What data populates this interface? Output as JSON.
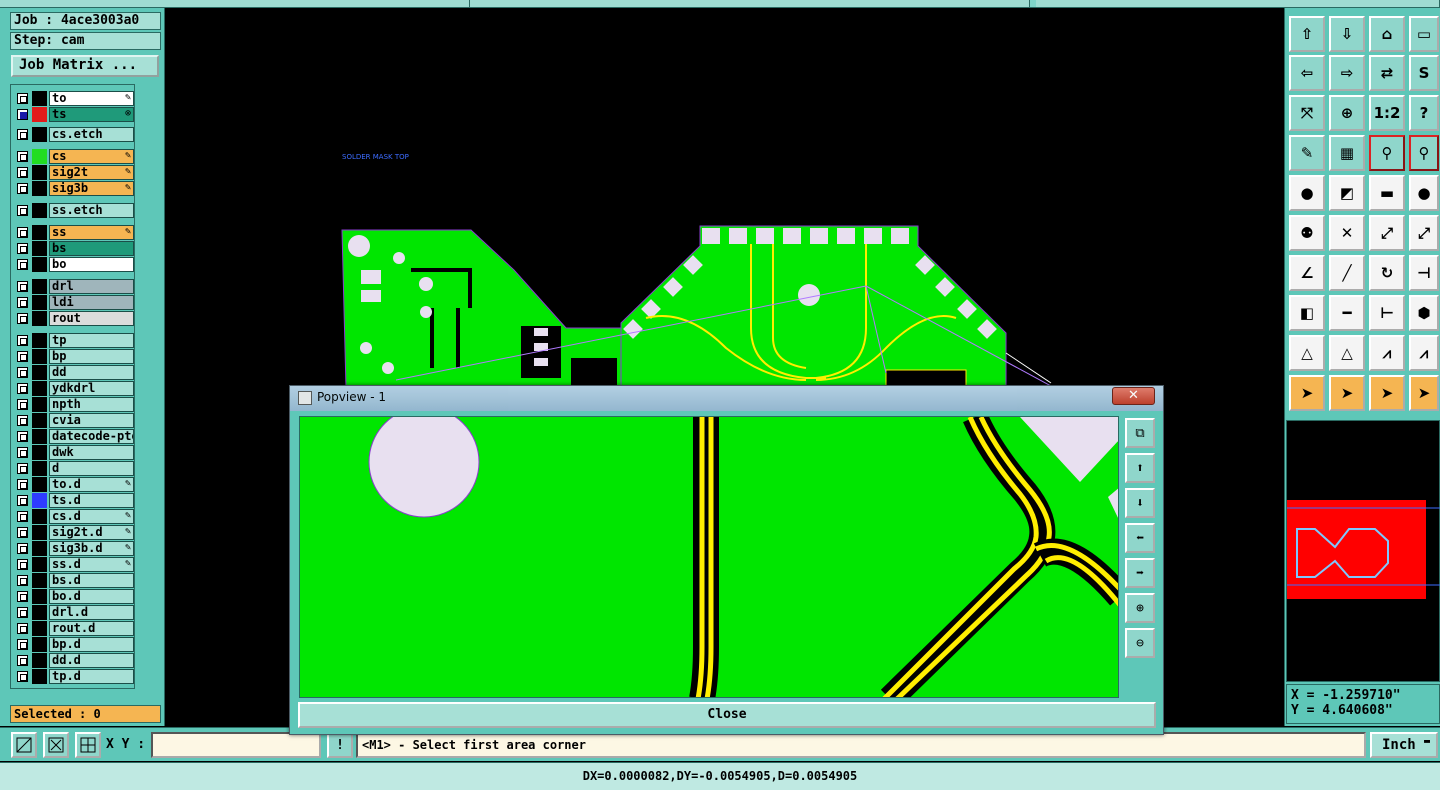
{
  "job": {
    "job_label": "Job : 4ace3003a0",
    "step_label": "Step: cam",
    "matrix_button": "Job Matrix ..."
  },
  "layers": [
    {
      "name": "to",
      "bg": "#ffffff",
      "color": "#000000",
      "flag": "✎",
      "checked": false
    },
    {
      "name": "ts",
      "bg": "#1f9a7a",
      "color": "#e31b1b",
      "flag": "⊗",
      "checked": true
    },
    {
      "name": "cs.etch",
      "bg": "#a7e0d6",
      "color": "#000000",
      "flag": "",
      "checked": false
    },
    {
      "name": "cs",
      "bg": "#f5b552",
      "color": "#22dd22",
      "flag": "✎",
      "checked": false
    },
    {
      "name": "sig2t",
      "bg": "#f5b552",
      "color": "#000000",
      "flag": "✎",
      "checked": false
    },
    {
      "name": "sig3b",
      "bg": "#f5b552",
      "color": "#000000",
      "flag": "✎",
      "checked": false
    },
    {
      "name": "ss.etch",
      "bg": "#a7e0d6",
      "color": "#000000",
      "flag": "",
      "checked": false
    },
    {
      "name": "ss",
      "bg": "#f5b552",
      "color": "#000000",
      "flag": "✎",
      "checked": false
    },
    {
      "name": "bs",
      "bg": "#1f9a7a",
      "color": "#000000",
      "flag": "",
      "checked": false
    },
    {
      "name": "bo",
      "bg": "#ffffff",
      "color": "#000000",
      "flag": "",
      "checked": false
    },
    {
      "name": "drl",
      "bg": "#9fb5bb",
      "color": "#000000",
      "flag": "",
      "checked": false
    },
    {
      "name": "ldi",
      "bg": "#9fb5bb",
      "color": "#000000",
      "flag": "",
      "checked": false
    },
    {
      "name": "rout",
      "bg": "#dcdcdc",
      "color": "#000000",
      "flag": "",
      "checked": false
    },
    {
      "name": "tp",
      "bg": "#a7e0d6",
      "color": "#000000",
      "flag": "",
      "checked": false
    },
    {
      "name": "bp",
      "bg": "#a7e0d6",
      "color": "#000000",
      "flag": "",
      "checked": false
    },
    {
      "name": "dd",
      "bg": "#a7e0d6",
      "color": "#000000",
      "flag": "",
      "checked": false
    },
    {
      "name": "ydkdrl",
      "bg": "#a7e0d6",
      "color": "#000000",
      "flag": "",
      "checked": false
    },
    {
      "name": "npth",
      "bg": "#a7e0d6",
      "color": "#000000",
      "flag": "",
      "checked": false
    },
    {
      "name": "cvia",
      "bg": "#a7e0d6",
      "color": "#000000",
      "flag": "",
      "checked": false
    },
    {
      "name": "datecode-pte",
      "bg": "#a7e0d6",
      "color": "#000000",
      "flag": "",
      "checked": false
    },
    {
      "name": "dwk",
      "bg": "#a7e0d6",
      "color": "#000000",
      "flag": "",
      "checked": false
    },
    {
      "name": "d",
      "bg": "#a7e0d6",
      "color": "#000000",
      "flag": "",
      "checked": false
    },
    {
      "name": "to.d",
      "bg": "#a7e0d6",
      "color": "#000000",
      "flag": "✎",
      "checked": false
    },
    {
      "name": "ts.d",
      "bg": "#a7e0d6",
      "color": "#2e3cff",
      "flag": "",
      "checked": false
    },
    {
      "name": "cs.d",
      "bg": "#a7e0d6",
      "color": "#000000",
      "flag": "✎",
      "checked": false
    },
    {
      "name": "sig2t.d",
      "bg": "#a7e0d6",
      "color": "#000000",
      "flag": "✎",
      "checked": false
    },
    {
      "name": "sig3b.d",
      "bg": "#a7e0d6",
      "color": "#000000",
      "flag": "✎",
      "checked": false
    },
    {
      "name": "ss.d",
      "bg": "#a7e0d6",
      "color": "#000000",
      "flag": "✎",
      "checked": false
    },
    {
      "name": "bs.d",
      "bg": "#a7e0d6",
      "color": "#000000",
      "flag": "",
      "checked": false
    },
    {
      "name": "bo.d",
      "bg": "#a7e0d6",
      "color": "#000000",
      "flag": "",
      "checked": false
    },
    {
      "name": "drl.d",
      "bg": "#a7e0d6",
      "color": "#000000",
      "flag": "",
      "checked": false
    },
    {
      "name": "rout.d",
      "bg": "#a7e0d6",
      "color": "#000000",
      "flag": "",
      "checked": false
    },
    {
      "name": "bp.d",
      "bg": "#a7e0d6",
      "color": "#000000",
      "flag": "",
      "checked": false
    },
    {
      "name": "dd.d",
      "bg": "#a7e0d6",
      "color": "#000000",
      "flag": "",
      "checked": false
    },
    {
      "name": "tp.d",
      "bg": "#a7e0d6",
      "color": "#000000",
      "flag": "",
      "checked": false
    }
  ],
  "selected_label": "Selected : 0",
  "canvas": {
    "layer_text": "SOLDER MASK TOP"
  },
  "popview": {
    "title": "Popview - 1",
    "close_x": "✕",
    "close_button": "Close"
  },
  "coords": {
    "x": "X = -1.259710\"",
    "y": "Y = 4.640608\""
  },
  "status": {
    "xy_label": "X Y :",
    "xy_value": "",
    "prompt_icon": "!",
    "message": "<M1> - Select first area corner",
    "unit": "Inch",
    "delta": "DX=0.0000082,DY=-0.0054905,D=0.0054905"
  },
  "right_tools": [
    [
      "",
      "",
      "",
      ""
    ],
    [
      "",
      "",
      "",
      ""
    ],
    [
      "",
      "",
      "1:2",
      "?"
    ],
    [
      "",
      "",
      "",
      ""
    ],
    [
      "",
      "",
      "",
      ""
    ],
    [
      "",
      "",
      "",
      ""
    ],
    [
      "",
      "",
      "",
      ""
    ],
    [
      "",
      "",
      "",
      ""
    ],
    [
      "",
      "",
      "",
      ""
    ],
    [
      "",
      "",
      "",
      ""
    ]
  ],
  "colors": {
    "panel": "#5ec7b8",
    "board": "#00e600",
    "trace": "#ffee00",
    "highlight": "#f5b552"
  }
}
